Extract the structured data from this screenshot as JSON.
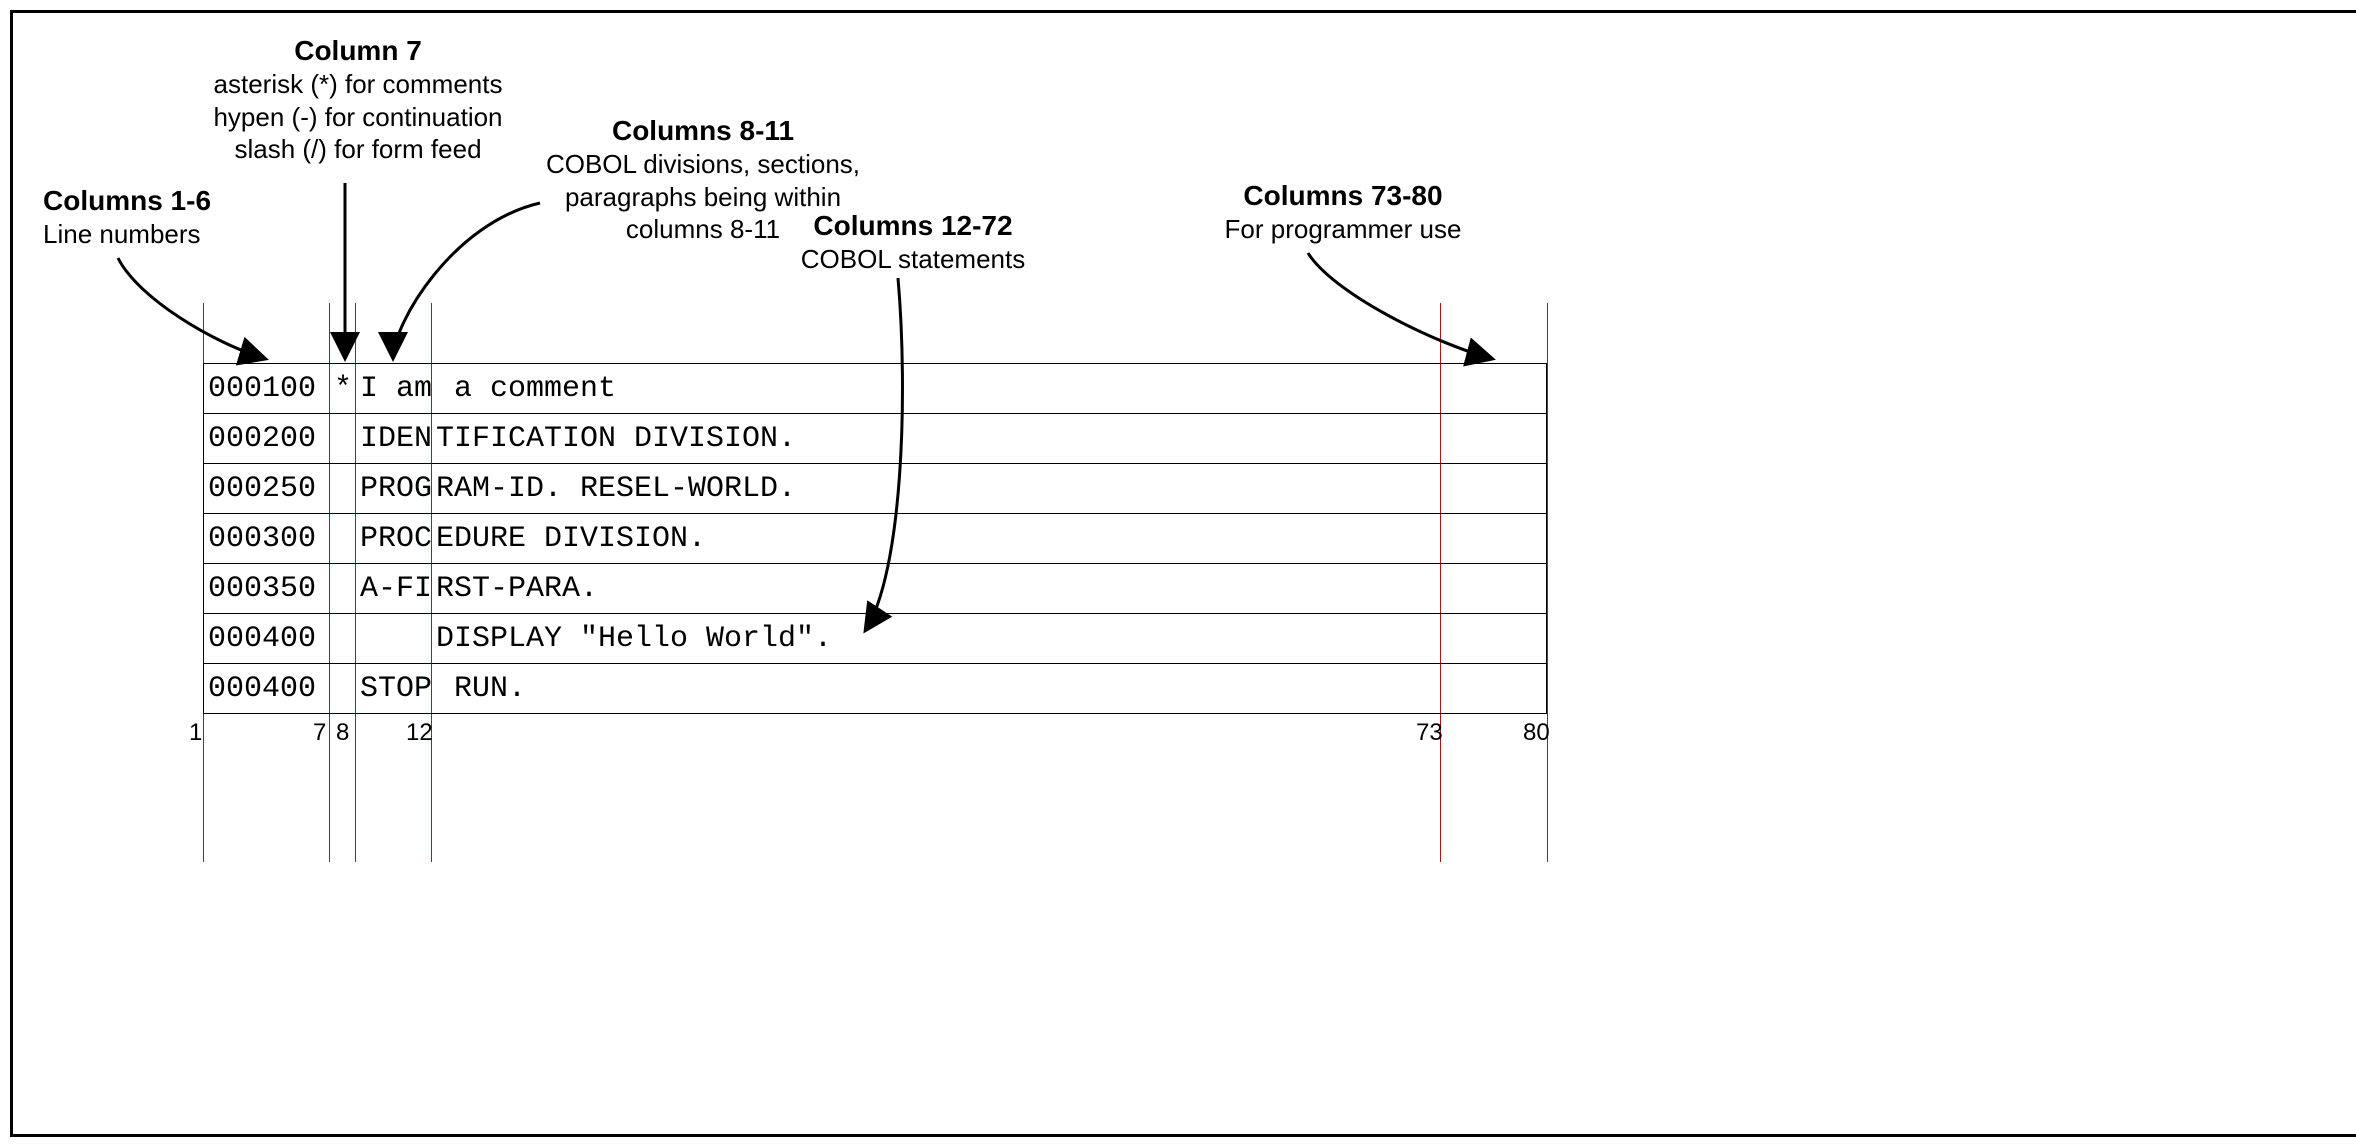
{
  "labels": {
    "col1_6": {
      "title": "Columns 1-6",
      "sub": "Line numbers"
    },
    "col7": {
      "title": "Column 7",
      "sub1": "asterisk (*) for comments",
      "sub2": "hypen (-) for continuation",
      "sub3": "slash (/) for form feed"
    },
    "col8_11": {
      "title": "Columns 8-11",
      "sub1": "COBOL divisions, sections,",
      "sub2": "paragraphs being within",
      "sub3": "columns 8-11"
    },
    "col12_72": {
      "title": "Columns 12-72",
      "sub": "COBOL statements"
    },
    "col73_80": {
      "title": "Columns 73-80",
      "sub": "For programmer use"
    }
  },
  "ticks": {
    "t1": "1",
    "t7": "7",
    "t8": "8",
    "t12": "12",
    "t73": "73",
    "t80": "80"
  },
  "code": [
    {
      "num": "000100",
      "ind": "*",
      "area": "I am",
      "body": " a comment"
    },
    {
      "num": "000200",
      "ind": "",
      "area": "IDEN",
      "body": "TIFICATION DIVISION."
    },
    {
      "num": "000250",
      "ind": "",
      "area": "PROG",
      "body": "RAM-ID. RESEL-WORLD."
    },
    {
      "num": "000300",
      "ind": "",
      "area": "PROC",
      "body": "EDURE DIVISION."
    },
    {
      "num": "000350",
      "ind": "",
      "area": "A-FI",
      "body": "RST-PARA."
    },
    {
      "num": "000400",
      "ind": "",
      "area": "",
      "body": "DISPLAY \"Hello World\"."
    },
    {
      "num": "000400",
      "ind": "",
      "area": "STOP",
      "body": " RUN."
    }
  ]
}
